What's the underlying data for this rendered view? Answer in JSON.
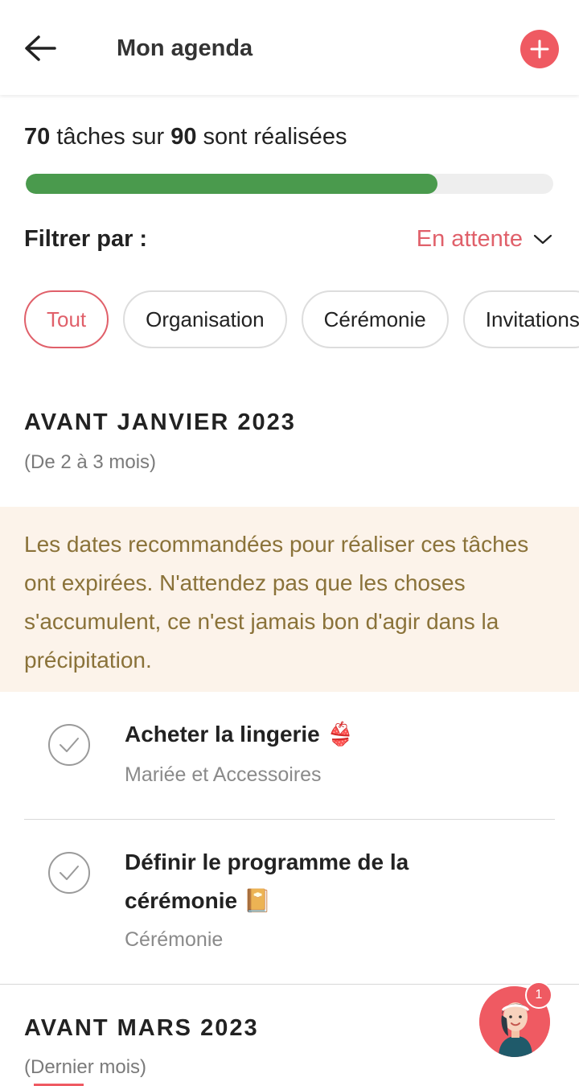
{
  "header": {
    "title": "Mon agenda",
    "back_icon": "arrow-left-icon",
    "add_icon": "plus-icon",
    "accent_color": "#ef5a62"
  },
  "progress": {
    "done": "70",
    "text_middle": "tâches sur",
    "total": "90",
    "text_end": "sont réalisées",
    "fraction": 0.78,
    "fill_color": "#4a9a4d"
  },
  "filter": {
    "label": "Filtrer par :",
    "value": "En attente",
    "icon": "chevron-down-icon"
  },
  "chips": [
    {
      "label": "Tout",
      "active": true
    },
    {
      "label": "Organisation",
      "active": false
    },
    {
      "label": "Cérémonie",
      "active": false
    },
    {
      "label": "Invitations",
      "active": false
    }
  ],
  "sections": [
    {
      "title": "AVANT JANVIER 2023",
      "subtitle": "(De 2 à 3 mois)",
      "warning": "Les dates recommandées pour réaliser ces tâches ont expirées. N'attendez pas que les choses s'accumulent, ce n'est jamais bon d'agir dans la précipitation.",
      "tasks": [
        {
          "line1": "Acheter la lingerie 👙",
          "line2": "",
          "category": "Mariée et Accessoires"
        },
        {
          "line1": "Définir le programme de la",
          "line2": "cérémonie 📔",
          "category": "Cérémonie"
        }
      ]
    },
    {
      "title": "AVANT MARS 2023",
      "subtitle": "(Dernier mois)"
    }
  ],
  "assistant": {
    "icon": "assistant-avatar-icon",
    "badge": "1"
  }
}
